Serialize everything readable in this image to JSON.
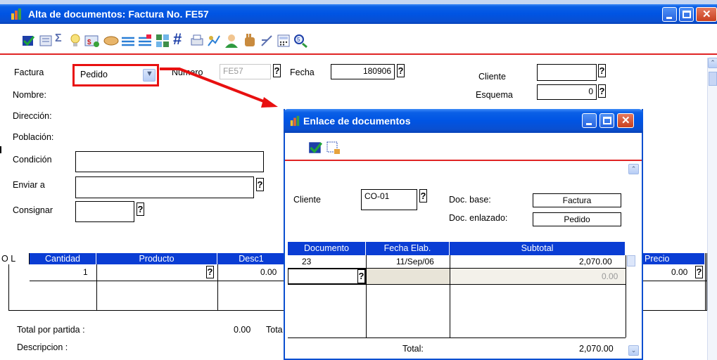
{
  "main_window": {
    "title": "Alta de documentos: Factura No. FE57",
    "form": {
      "factura_label": "Factura",
      "doc_type_value": "Pedido",
      "numero_label": "Numero",
      "numero_value": "FE57",
      "fecha_label": "Fecha",
      "fecha_value": "180906",
      "cliente_label": "Cliente",
      "cliente_value": "",
      "esquema_label": "Esquema",
      "esquema_value": "0",
      "nombre_label": "Nombre:",
      "direccion_label": "Dirección:",
      "poblacion_label": "Población:",
      "condicion_label": "Condición",
      "enviar_label": "Enviar a",
      "consignar_label": "Consignar"
    },
    "grid": {
      "headers": [
        "O L",
        "Cantidad",
        "Producto",
        "Desc1",
        "Precio"
      ],
      "row1": {
        "cantidad": "1",
        "desc1": "0.00",
        "precio": "0.00"
      }
    },
    "footer": {
      "total_partida_label": "Total por partida :",
      "total_partida_value": "0.00",
      "total_label_partial": "Tota",
      "descripcion_label": "Descripcion :"
    }
  },
  "dialog": {
    "title": "Enlace de documentos",
    "cliente_label": "Cliente",
    "cliente_value": "CO-01",
    "doc_base_label": "Doc. base:",
    "doc_base_value": "Factura",
    "doc_enlazado_label": "Doc. enlazado:",
    "doc_enlazado_value": "Pedido",
    "table": {
      "headers": [
        "Documento",
        "Fecha Elab.",
        "Subtotal"
      ],
      "rows": [
        {
          "documento": "23",
          "fecha": "11/Sep/06",
          "subtotal": "2,070.00"
        },
        {
          "documento": "",
          "fecha": "",
          "subtotal": "0.00"
        }
      ]
    },
    "total_label": "Total:",
    "total_value": "2,070.00"
  },
  "colors": {
    "titlebar": "#0054e3",
    "grid_header": "#0a3dd4",
    "highlight_red": "#e81010"
  },
  "icons": [
    "save-icon",
    "sigma-icon",
    "bulb-icon",
    "money-icon",
    "handshake-icon",
    "lines-icon",
    "hash-icon",
    "print-icon",
    "user-icon",
    "hand-icon",
    "calculator-icon"
  ]
}
